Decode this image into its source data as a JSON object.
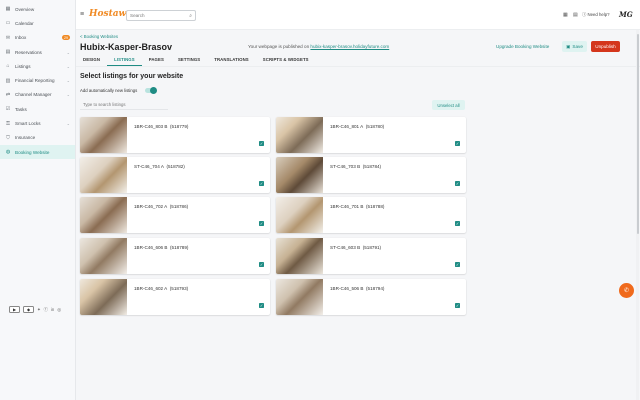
{
  "sidebar": {
    "items": [
      {
        "label": "Overview",
        "icon": "grid-icon"
      },
      {
        "label": "Calendar",
        "icon": "calendar-icon"
      },
      {
        "label": "Inbox",
        "icon": "inbox-icon",
        "badge": "29"
      },
      {
        "label": "Reservations",
        "icon": "reservations-icon",
        "chevron": true
      },
      {
        "label": "Listings",
        "icon": "home-icon",
        "chevron": true
      },
      {
        "label": "Financial Reporting",
        "icon": "chart-icon",
        "chevron": true
      },
      {
        "label": "Channel Manager",
        "icon": "channel-icon",
        "chevron": true
      },
      {
        "label": "Tasks",
        "icon": "tasks-icon"
      },
      {
        "label": "Smart Locks",
        "icon": "lock-icon",
        "chevron": true
      },
      {
        "label": "Insurance",
        "icon": "shield-icon"
      },
      {
        "label": "Booking Website",
        "icon": "globe-icon",
        "active": true
      }
    ]
  },
  "topbar": {
    "logo": "Hostaway",
    "search_placeholder": "Search",
    "help": "Need help?",
    "avatar": "MG"
  },
  "header": {
    "breadcrumb": "< Booking Websites",
    "title": "Hubix-Kasper-Brasov",
    "published_prefix": "Your webpage is published on",
    "published_link": "hubix-kasper-brasov.holidayfuture.com",
    "upgrade": "Upgrade Booking Website",
    "save": "Save",
    "unpublish": "Unpublish"
  },
  "tabs": [
    "DESIGN",
    "LISTINGS",
    "PAGES",
    "SETTINGS",
    "TRANSLATIONS",
    "SCRIPTS & WIDGETS"
  ],
  "listings_section": {
    "title": "Select listings for your website",
    "auto_add_label": "Add automatically new listings",
    "search_placeholder": "Type to search listings",
    "unselect_all": "Unselect all"
  },
  "listings": [
    {
      "name": "1BR-C46_803 B",
      "id": "(518779)",
      "checked": true
    },
    {
      "name": "1BR-C46_801 A",
      "id": "(518780)",
      "checked": true
    },
    {
      "name": "ST-C46_704 A",
      "id": "(518782)",
      "checked": true
    },
    {
      "name": "ST-C46_703 B",
      "id": "(518784)",
      "checked": true
    },
    {
      "name": "1BR-C46_702 A",
      "id": "(518786)",
      "checked": true
    },
    {
      "name": "1BR-C46_701 B",
      "id": "(518788)",
      "checked": true
    },
    {
      "name": "1BR-C46_606 B",
      "id": "(518789)",
      "checked": true
    },
    {
      "name": "ST-C46_603 B",
      "id": "(518791)",
      "checked": true
    },
    {
      "name": "1BR-C46_602 A",
      "id": "(518793)",
      "checked": true
    },
    {
      "name": "1BR-C46_506 B",
      "id": "(518794)",
      "checked": true
    }
  ],
  "colors": {
    "accent": "#1f8c84",
    "danger": "#d4361c",
    "brand": "#f08a24"
  }
}
